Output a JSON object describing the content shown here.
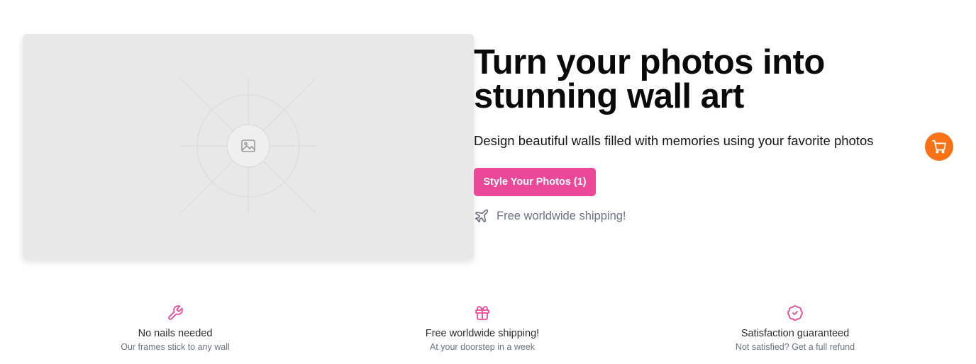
{
  "hero": {
    "image_placeholder_icon": "image-icon",
    "headline": "Turn your photos into stunning wall art",
    "subtitle": "Design beautiful walls filled with memories using your favorite photos",
    "cta_label": "Style Your Photos (1)",
    "shipping_icon": "plane-icon",
    "shipping_text": "Free worldwide shipping!"
  },
  "cart": {
    "icon": "cart-icon"
  },
  "features": [
    {
      "icon": "wrench-icon",
      "title": "No nails needed",
      "subtitle": "Our frames stick to any wall"
    },
    {
      "icon": "gift-icon",
      "title": "Free worldwide shipping!",
      "subtitle": "At your doorstep in a week"
    },
    {
      "icon": "badge-check-icon",
      "title": "Satisfaction guaranteed",
      "subtitle": "Not satisfied? Get a full refund"
    }
  ],
  "colors": {
    "accent": "#ec4899",
    "cart": "#f97316",
    "muted": "#6b7280"
  }
}
